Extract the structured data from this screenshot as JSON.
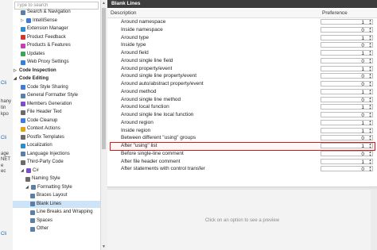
{
  "underlying": {
    "lines": [
      {
        "text": "Cli",
        "cls": "blue"
      },
      {
        "text": "hany",
        "cls": "dark"
      },
      {
        "text": "tin",
        "cls": "dark"
      },
      {
        "text": "kpo",
        "cls": "dark"
      },
      {
        "text": "Cli",
        "cls": "blue"
      },
      {
        "text": "age",
        "cls": "dark"
      },
      {
        "text": "NET",
        "cls": "dark"
      },
      {
        "text": "e",
        "cls": "dark"
      },
      {
        "text": "ec",
        "cls": "dark"
      },
      {
        "text": "Cli",
        "cls": "blue"
      }
    ]
  },
  "search": {
    "placeholder": "Type to search"
  },
  "tree": {
    "items": [
      {
        "label": "Search & Navigation",
        "indent": 2,
        "icon": "binoculars-icon",
        "color": "#5b7fa6",
        "arrow": ""
      },
      {
        "label": "IntelliSense",
        "indent": 2,
        "icon": "intellisense-icon",
        "color": "#3b7dd8",
        "arrow": "▷"
      },
      {
        "label": "Extension Manager",
        "indent": 2,
        "icon": "puzzle-icon",
        "color": "#2f8bd0",
        "arrow": ""
      },
      {
        "label": "Product Feedback",
        "indent": 2,
        "icon": "feedback-icon",
        "color": "#d0392b",
        "arrow": ""
      },
      {
        "label": "Products & Features",
        "indent": 2,
        "icon": "products-icon",
        "color": "#c93cb3",
        "arrow": ""
      },
      {
        "label": "Updates",
        "indent": 2,
        "icon": "updates-icon",
        "color": "#3aa55c",
        "arrow": ""
      },
      {
        "label": "Web Proxy Settings",
        "indent": 2,
        "icon": "globe-icon",
        "color": "#3b7dd8",
        "arrow": ""
      },
      {
        "label": "Code Inspection",
        "indent": 0,
        "icon": "",
        "color": "",
        "arrow": "▷",
        "bold": true
      },
      {
        "label": "Code Editing",
        "indent": 0,
        "icon": "",
        "color": "",
        "arrow": "◢",
        "bold": true
      },
      {
        "label": "Code Style Sharing",
        "indent": 2,
        "icon": "style-sharing-icon",
        "color": "#3b7dd8",
        "arrow": ""
      },
      {
        "label": "General Formatter Style",
        "indent": 2,
        "icon": "formatter-icon",
        "color": "#5b7fa6",
        "arrow": ""
      },
      {
        "label": "Members Generation",
        "indent": 2,
        "icon": "members-icon",
        "color": "#7a4fc9",
        "arrow": ""
      },
      {
        "label": "File Header Text",
        "indent": 2,
        "icon": "file-header-icon",
        "color": "#6b6b6b",
        "arrow": ""
      },
      {
        "label": "Code Cleanup",
        "indent": 2,
        "icon": "cleanup-icon",
        "color": "#3b7dd8",
        "arrow": ""
      },
      {
        "label": "Context Actions",
        "indent": 2,
        "icon": "context-actions-icon",
        "color": "#e0a11b",
        "arrow": ""
      },
      {
        "label": "Postfix Templates",
        "indent": 2,
        "icon": "postfix-icon",
        "color": "#6b6b6b",
        "arrow": ""
      },
      {
        "label": "Localization",
        "indent": 2,
        "icon": "localization-icon",
        "color": "#2f8bd0",
        "arrow": ""
      },
      {
        "label": "Language Injections",
        "indent": 2,
        "icon": "injection-icon",
        "color": "#5b7fa6",
        "arrow": ""
      },
      {
        "label": "Third-Party Code",
        "indent": 2,
        "icon": "third-party-icon",
        "color": "#6b6b6b",
        "arrow": ""
      },
      {
        "label": "C#",
        "indent": 2,
        "icon": "csharp-icon",
        "color": "#7a4fc9",
        "arrow": "◢"
      },
      {
        "label": "Naming Style",
        "indent": 3,
        "icon": "naming-icon",
        "color": "#6b6b6b",
        "arrow": ""
      },
      {
        "label": "Formatting Style",
        "indent": 3,
        "icon": "formatting-icon",
        "color": "#5b7fa6",
        "arrow": "◢"
      },
      {
        "label": "Braces Layout",
        "indent": 4,
        "icon": "braces-icon",
        "color": "#5b7fa6",
        "arrow": ""
      },
      {
        "label": "Blank Lines",
        "indent": 4,
        "icon": "blank-lines-icon",
        "color": "#5b7fa6",
        "arrow": "",
        "selected": true
      },
      {
        "label": "Line Breaks and Wrapping",
        "indent": 4,
        "icon": "line-breaks-icon",
        "color": "#5b7fa6",
        "arrow": ""
      },
      {
        "label": "Spaces",
        "indent": 4,
        "icon": "spaces-icon",
        "color": "#5b7fa6",
        "arrow": ""
      },
      {
        "label": "Other",
        "indent": 4,
        "icon": "other-icon",
        "color": "#5b7fa6",
        "arrow": ""
      }
    ]
  },
  "panel": {
    "title": "Blank Lines",
    "col_description": "Description",
    "col_preference": "Preference",
    "rows": [
      {
        "label": "Around namespace",
        "value": "1"
      },
      {
        "label": "Inside namespace",
        "value": "0"
      },
      {
        "label": "Around type",
        "value": "1"
      },
      {
        "label": "Inside type",
        "value": "0"
      },
      {
        "label": "Around field",
        "value": "1"
      },
      {
        "label": "Around single line field",
        "value": "0"
      },
      {
        "label": "Around property/event",
        "value": "1"
      },
      {
        "label": "Around single line property/event",
        "value": "0"
      },
      {
        "label": "Around auto/abstract property/event",
        "value": "0"
      },
      {
        "label": "Around method",
        "value": "1"
      },
      {
        "label": "Around single line method",
        "value": "0"
      },
      {
        "label": "Around local function",
        "value": "1"
      },
      {
        "label": "Around single line local function",
        "value": "0"
      },
      {
        "label": "Around region",
        "value": "1"
      },
      {
        "label": "Inside region",
        "value": "1"
      },
      {
        "label": "Between different \"using\" groups",
        "value": "0"
      },
      {
        "label": "After \"using\" list",
        "value": "1",
        "highlight": true
      },
      {
        "label": "Before single-line comment",
        "value": "0"
      },
      {
        "label": "After file header comment",
        "value": "1"
      },
      {
        "label": "After statements with control transfer",
        "value": "0"
      }
    ],
    "preview_hint": "Click on an option to see a preview"
  },
  "colors": {
    "accent": "#d9181b",
    "selection": "#cde3f7",
    "titlebar": "#3e3e3e"
  }
}
